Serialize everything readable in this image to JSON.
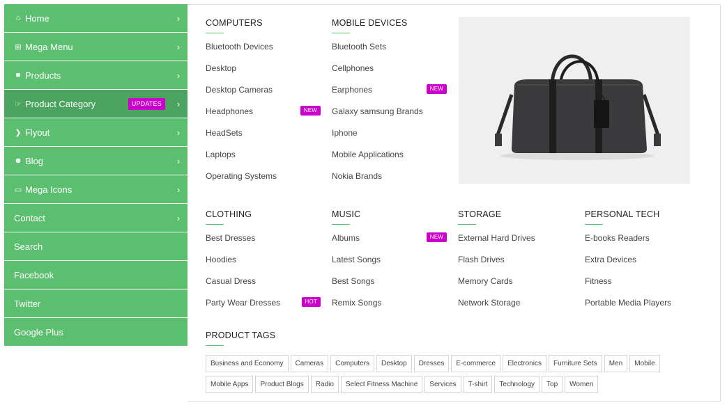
{
  "sidebar": {
    "items": [
      {
        "label": "Home",
        "icon": "home-icon",
        "chevron": true
      },
      {
        "label": "Mega Menu",
        "icon": "plus-square-icon",
        "chevron": true
      },
      {
        "label": "Products",
        "icon": "gift-icon",
        "chevron": true
      },
      {
        "label": "Product Category",
        "icon": "hand-pointer-icon",
        "chevron": true,
        "badge": "UPDATES",
        "active": true
      },
      {
        "label": "Flyout",
        "icon": "chevron-circle-icon",
        "chevron": true
      },
      {
        "label": "Blog",
        "icon": "users-icon",
        "chevron": true
      },
      {
        "label": "Mega Icons",
        "icon": "inbox-icon",
        "chevron": true
      },
      {
        "label": "Contact",
        "chevron": true
      },
      {
        "label": "Search"
      },
      {
        "label": "Facebook"
      },
      {
        "label": "Twitter"
      },
      {
        "label": "Google Plus"
      }
    ]
  },
  "columns": {
    "computers": {
      "title": "COMPUTERS",
      "links": [
        {
          "label": "Bluetooth Devices"
        },
        {
          "label": "Desktop"
        },
        {
          "label": "Desktop Cameras"
        },
        {
          "label": "Headphones",
          "badge": "NEW"
        },
        {
          "label": "HeadSets"
        },
        {
          "label": "Laptops"
        },
        {
          "label": "Operating Systems"
        }
      ]
    },
    "mobile": {
      "title": "MOBILE DEVICES",
      "links": [
        {
          "label": "Bluetooth Sets"
        },
        {
          "label": "Cellphones"
        },
        {
          "label": "Earphones",
          "badge": "NEW"
        },
        {
          "label": "Galaxy samsung Brands"
        },
        {
          "label": "Iphone"
        },
        {
          "label": "Mobile Applications"
        },
        {
          "label": "Nokia Brands"
        }
      ]
    },
    "clothing": {
      "title": "CLOTHING",
      "links": [
        {
          "label": "Best Dresses"
        },
        {
          "label": "Hoodies"
        },
        {
          "label": "Casual Dress"
        },
        {
          "label": "Party Wear Dresses",
          "badge": "HOT"
        }
      ]
    },
    "music": {
      "title": "MUSIC",
      "links": [
        {
          "label": "Albums",
          "badge": "NEW"
        },
        {
          "label": "Latest Songs"
        },
        {
          "label": "Best Songs"
        },
        {
          "label": "Remix Songs"
        }
      ]
    },
    "storage": {
      "title": "STORAGE",
      "links": [
        {
          "label": "External Hard Drives"
        },
        {
          "label": "Flash Drives"
        },
        {
          "label": "Memory Cards"
        },
        {
          "label": "Network Storage"
        }
      ]
    },
    "personal": {
      "title": "PERSONAL TECH",
      "links": [
        {
          "label": "E-books Readers"
        },
        {
          "label": "Extra Devices"
        },
        {
          "label": "Fitness"
        },
        {
          "label": "Portable Media Players"
        }
      ]
    }
  },
  "product_tags": {
    "title": "PRODUCT TAGS",
    "row1": [
      "Business and Economy",
      "Cameras",
      "Computers",
      "Desktop",
      "Dresses",
      "E-commerce",
      "Electronics",
      "Furniture Sets",
      "Men",
      "Mobile"
    ],
    "row2": [
      "Mobile Apps",
      "Product Blogs",
      "Radio",
      "Select Fitness Machine",
      "Services",
      "T-shirt",
      "Technology",
      "Top",
      "Women"
    ]
  },
  "colors": {
    "sidebar": "#5cbf70",
    "sidebar_active": "#4aa35f",
    "badge": "#cc00cc",
    "accent_line": "#5cbf70"
  }
}
